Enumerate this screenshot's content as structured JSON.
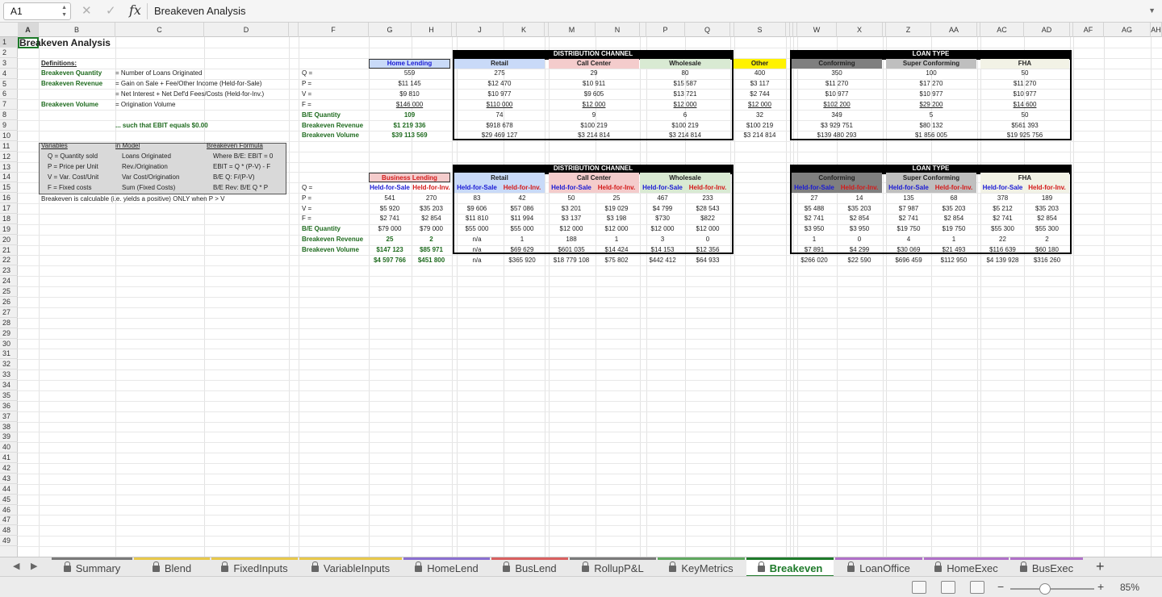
{
  "formula_bar": {
    "cell_ref": "A1",
    "formula_label": "fx",
    "value": "Breakeven Analysis"
  },
  "columns": [
    "A",
    "B",
    "C",
    "D",
    "E",
    "F",
    "G",
    "H",
    "I",
    "J",
    "K",
    "L",
    "M",
    "N",
    "O",
    "P",
    "Q",
    "R",
    "S",
    "T",
    "U",
    "V",
    "W",
    "X",
    "Y",
    "Z",
    "AA",
    "AB",
    "AC",
    "AD",
    "AE",
    "AF",
    "AG",
    "AH"
  ],
  "rows": [
    "1",
    "2",
    "3",
    "4",
    "5",
    "6",
    "7",
    "8",
    "9",
    "10",
    "11",
    "12",
    "13",
    "14",
    "15",
    "16",
    "17",
    "18",
    "19",
    "20",
    "21",
    "22",
    "23",
    "24",
    "25",
    "26",
    "27",
    "28",
    "29",
    "30",
    "31",
    "32",
    "33",
    "34",
    "35",
    "36",
    "37",
    "38",
    "39",
    "40",
    "41",
    "42",
    "43",
    "44",
    "45",
    "46",
    "47",
    "48",
    "49"
  ],
  "sheet": {
    "title": "Breakeven Analysis",
    "defs_heading": "Definitions:",
    "defs": [
      {
        "term": "Breakeven Quantity",
        "def": "= Number of Loans Originated"
      },
      {
        "term": "Breakeven Revenue",
        "def": "= Gain on Sale + Fee/Other Income (Held-for-Sale)"
      },
      {
        "term": "",
        "def": "= Net Interest + Net Def'd Fees/Costs (Held-for-Inv.)"
      },
      {
        "term": "Breakeven Volume",
        "def": "= Origination Volume"
      }
    ],
    "ebit_note": "... such that EBIT equals $0.00",
    "vars_box": {
      "headers": [
        "Variables",
        "in Model",
        "Breakeven Formula"
      ],
      "rows": [
        [
          "Q = Quantity sold",
          "Loans Originated",
          "Where B/E: EBIT = 0"
        ],
        [
          "P = Price per Unit",
          "Rev./Origination",
          "EBIT = Q * (P-V) - F"
        ],
        [
          "V = Var. Cost/Unit",
          "Var Cost/Origination",
          "B/E Q:  F/(P-V)"
        ],
        [
          "F = Fixed costs",
          "Sum (Fixed Costs)",
          "B/E Rev: B/E Q * P"
        ]
      ]
    },
    "calc_note": "Breakeven is calculable (i.e. yields a positive) ONLY when P > V",
    "labels1": [
      "Q =",
      "P =",
      "V =",
      "F =",
      "B/E Quantity",
      "Breakeven Revenue",
      "Breakeven Volume"
    ],
    "labels2": [
      "Q =",
      "P =",
      "V =",
      "F =",
      "B/E Quantity",
      "Breakeven Revenue",
      "Breakeven Volume"
    ],
    "dist_title": "DISTRIBUTION CHANNEL",
    "loan_title": "LOAN TYPE",
    "home_lending": {
      "name": "Home Lending",
      "values": [
        "559",
        "$11 145",
        "$9 810",
        "$146 000",
        "109",
        "$1 219 336",
        "$39 113 569"
      ]
    },
    "table1": [
      {
        "name": "Retail",
        "values": [
          "275",
          "$12 470",
          "$10 977",
          "$110 000",
          "74",
          "$918 678",
          "$29 469 127"
        ]
      },
      {
        "name": "Call Center",
        "values": [
          "29",
          "$10 911",
          "$9 605",
          "$12 000",
          "9",
          "$100 219",
          "$3 214 814"
        ]
      },
      {
        "name": "Wholesale",
        "values": [
          "80",
          "$15 587",
          "$13 721",
          "$12 000",
          "6",
          "$100 219",
          "$3 214 814"
        ]
      },
      {
        "name": "Other",
        "values": [
          "400",
          "$3 117",
          "$2 744",
          "$12 000",
          "32",
          "$100 219",
          "$3 214 814"
        ]
      },
      {
        "name": "Conforming",
        "values": [
          "350",
          "$11 270",
          "$10 977",
          "$102 200",
          "349",
          "$3 929 751",
          "$139 480 293"
        ]
      },
      {
        "name": "Super Conforming",
        "values": [
          "100",
          "$17 270",
          "$10 977",
          "$29 200",
          "5",
          "$80 132",
          "$1 856 005"
        ]
      },
      {
        "name": "FHA",
        "values": [
          "50",
          "$11 270",
          "$10 977",
          "$14 600",
          "50",
          "$561 393",
          "$19 925 756"
        ]
      }
    ],
    "business_lending": {
      "name": "Business Lending",
      "hfs": "Held-for-Sale",
      "hfi": "Held-for-Inv.",
      "values": [
        [
          "541",
          "270"
        ],
        [
          "$5 920",
          "$35 203"
        ],
        [
          "$2 741",
          "$2 854"
        ],
        [
          "$79 000",
          "$79 000"
        ],
        [
          "25",
          "2"
        ],
        [
          "$147 123",
          "$85 971"
        ],
        [
          "$4 597 766",
          "$451 800"
        ]
      ]
    },
    "table2": [
      {
        "name": "Retail",
        "hfs": "Held-for-Sale",
        "hfi": "Held-for-Inv.",
        "values": [
          [
            "83",
            "42"
          ],
          [
            "$9 606",
            "$57 086"
          ],
          [
            "$11 810",
            "$11 994"
          ],
          [
            "$55 000",
            "$55 000"
          ],
          [
            "n/a",
            "1"
          ],
          [
            "n/a",
            "$69 629"
          ],
          [
            "n/a",
            "$365 920"
          ]
        ]
      },
      {
        "name": "Call Center",
        "hfs": "Held-for-Sale",
        "hfi": "Held-for-Inv.",
        "values": [
          [
            "50",
            "25"
          ],
          [
            "$3 201",
            "$19 029"
          ],
          [
            "$3 137",
            "$3 198"
          ],
          [
            "$12 000",
            "$12 000"
          ],
          [
            "188",
            "1"
          ],
          [
            "$601 035",
            "$14 424"
          ],
          [
            "$18 779 108",
            "$75 802"
          ]
        ]
      },
      {
        "name": "Wholesale",
        "hfs": "Held-for-Sale",
        "hfi": "Held-for-Inv.",
        "values": [
          [
            "467",
            "233"
          ],
          [
            "$4 799",
            "$28 543"
          ],
          [
            "$730",
            "$822"
          ],
          [
            "$12 000",
            "$12 000"
          ],
          [
            "3",
            "0"
          ],
          [
            "$14 153",
            "$12 356"
          ],
          [
            "$442 412",
            "$64 933"
          ]
        ]
      },
      {
        "name": "Conforming",
        "hfs": "Held-for-Sale",
        "hfi": "Held-for-Inv.",
        "values": [
          [
            "27",
            "14"
          ],
          [
            "$5 488",
            "$35 203"
          ],
          [
            "$2 741",
            "$2 854"
          ],
          [
            "$3 950",
            "$3 950"
          ],
          [
            "1",
            "0"
          ],
          [
            "$7 891",
            "$4 299"
          ],
          [
            "$266 020",
            "$22 590"
          ]
        ]
      },
      {
        "name": "Super Conforming",
        "hfs": "Held-for-Sale",
        "hfi": "Held-for-Inv.",
        "values": [
          [
            "135",
            "68"
          ],
          [
            "$7 987",
            "$35 203"
          ],
          [
            "$2 741",
            "$2 854"
          ],
          [
            "$19 750",
            "$19 750"
          ],
          [
            "4",
            "1"
          ],
          [
            "$30 069",
            "$21 493"
          ],
          [
            "$696 459",
            "$112 950"
          ]
        ]
      },
      {
        "name": "FHA",
        "hfs": "Held-for-Sale",
        "hfi": "Held-for-Inv.",
        "values": [
          [
            "378",
            "189"
          ],
          [
            "$5 212",
            "$35 203"
          ],
          [
            "$2 741",
            "$2 854"
          ],
          [
            "$55 300",
            "$55 300"
          ],
          [
            "22",
            "2"
          ],
          [
            "$116 639",
            "$60 180"
          ],
          [
            "$4 139 928",
            "$316 260"
          ]
        ]
      }
    ]
  },
  "tabs": [
    {
      "label": "Summary",
      "color": "#7a7a7a"
    },
    {
      "label": "Blend",
      "color": "#e8c84a"
    },
    {
      "label": "FixedInputs",
      "color": "#e8c84a"
    },
    {
      "label": "VariableInputs",
      "color": "#e8c84a"
    },
    {
      "label": "HomeLend",
      "color": "#8a6fd0"
    },
    {
      "label": "BusLend",
      "color": "#d86060"
    },
    {
      "label": "RollupP&L",
      "color": "#7a7a7a"
    },
    {
      "label": "KeyMetrics",
      "color": "#5fa85f"
    },
    {
      "label": "Breakeven",
      "color": "#1e7a2a"
    },
    {
      "label": "LoanOffice",
      "color": "#b070c8"
    },
    {
      "label": "HomeExec",
      "color": "#b070c8"
    },
    {
      "label": "BusExec",
      "color": "#b070c8"
    }
  ],
  "active_tab": "Breakeven",
  "zoom": "85%",
  "colors": {
    "blue_header": "#c9daf8",
    "pink_header": "#f4cccc",
    "green_header": "#d9ead3",
    "yellow_header": "#fff200",
    "dark_gray": "#7f7f7f",
    "light_gray": "#bfbfbf",
    "ivory": "#f2f2e6",
    "label_green": "#1f6b1f",
    "hfs_blue": "#1a1ad4",
    "hfi_red": "#d41a1a"
  }
}
